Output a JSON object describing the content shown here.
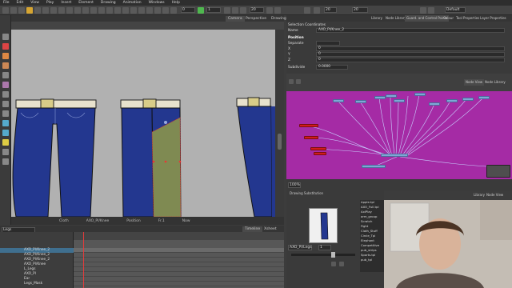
{
  "menu": [
    "File",
    "Edit",
    "View",
    "Play",
    "Insert",
    "Element",
    "Drawing",
    "Animation",
    "Windows",
    "Help"
  ],
  "toolbar": {
    "layer_field": "Legs",
    "frame_field": "Tier",
    "zoom_a": "0",
    "zoom_b": "1",
    "value_a": "20",
    "value_b": "20",
    "preset": "Default"
  },
  "camera": {
    "tabs": [
      "Camera",
      "Perspective",
      "Drawing"
    ],
    "status": [
      "Cloth",
      "AXO_Pl/Knee",
      "Position",
      "Fr.1",
      "Now"
    ],
    "accent_belt": "#e6e0cc",
    "accent_jeans": "#23378f",
    "accent_selection": "#7f8a52"
  },
  "timeline": {
    "tabs": [
      "Timeline",
      "Xsheet"
    ],
    "layer_field": "Legs",
    "layers": [
      "AXO_Pl/Knee_2",
      "AXO_Pl/Knee_2",
      "AXO_Pl/Knee_2",
      "AXO_Pl/Knee",
      "L_Legs",
      "AXO_Pl",
      "Ear",
      "Legs_Mask",
      "Ear"
    ]
  },
  "right_panel": {
    "tabs": [
      "Library",
      "Node Library",
      "Guard. and Control Points",
      "Colour",
      "Tool Properties",
      "Layer Properties"
    ],
    "props": {
      "section": "Selection Coordinates",
      "name_label": "Name",
      "name_value": "AXO_Pl/Knee_2",
      "position_label": "Position",
      "separate_label": "Separate",
      "x_label": "X",
      "x_value": "0",
      "y_label": "Y",
      "y_value": "0",
      "z_label": "Z",
      "z_value": "0",
      "sub_label": "Subdivide",
      "sub_value": "0.0000"
    },
    "node_tabs": [
      "Node View",
      "Node Library"
    ],
    "node_zoom": "100%"
  },
  "library": {
    "tabs": [
      "Drawing Substitution"
    ],
    "current": "AXO_Pl/Legs",
    "frame": "1",
    "items": [
      "Apple.tpl",
      "AXO_Full.tpl",
      "AxiPlay",
      "arm_group",
      "Scratch",
      "Fight",
      "Cloth_Stuff",
      "Circle_Tpl",
      "Elephant",
      "Competitive",
      "pub_strips",
      "Sports.tpl",
      "pub_tpl"
    ],
    "right_tabs": [
      "Library",
      "Node View"
    ]
  }
}
